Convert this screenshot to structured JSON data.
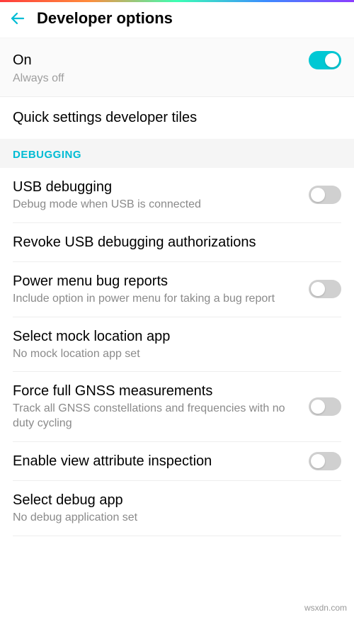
{
  "header": {
    "title": "Developer options"
  },
  "master": {
    "label": "On",
    "on": true
  },
  "prev_item": "Always off",
  "quick_tiles": "Quick settings developer tiles",
  "section": {
    "debugging": "DEBUGGING"
  },
  "rows": {
    "usb": {
      "title": "USB debugging",
      "sub": "Debug mode when USB is connected"
    },
    "revoke": {
      "title": "Revoke USB debugging authorizations"
    },
    "power": {
      "title": "Power menu bug reports",
      "sub": "Include option in power menu for taking a bug report"
    },
    "mock": {
      "title": "Select mock location app",
      "sub": "No mock location app set"
    },
    "gnss": {
      "title": "Force full GNSS measurements",
      "sub": "Track all GNSS constellations and frequencies with no duty cycling"
    },
    "inspect": {
      "title": "Enable view attribute inspection"
    },
    "debugapp": {
      "title": "Select debug app",
      "sub": "No debug application set"
    }
  },
  "watermark": "wsxdn.com"
}
